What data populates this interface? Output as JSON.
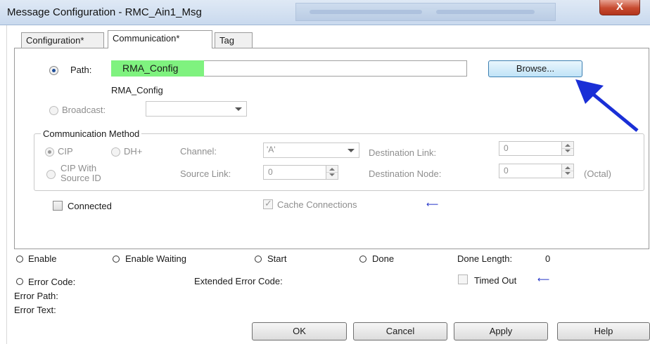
{
  "window": {
    "title": "Message Configuration - RMC_Ain1_Msg",
    "close_label": "X"
  },
  "tabs": [
    {
      "label": "Configuration*",
      "active": false
    },
    {
      "label": "Communication*",
      "active": true
    },
    {
      "label": "Tag",
      "active": false
    }
  ],
  "path": {
    "label": "Path:",
    "value": "RMA_Config",
    "resolved": "RMA_Config",
    "selected": true,
    "browse_label": "Browse..."
  },
  "broadcast": {
    "label": "Broadcast:",
    "value": ""
  },
  "comm_method": {
    "title": "Communication Method",
    "cip_label": "CIP",
    "dh_label": "DH+",
    "cip_with_source_label_1": "CIP With",
    "cip_with_source_label_2": "Source ID",
    "channel_label": "Channel:",
    "channel_value": "'A'",
    "source_link_label": "Source Link:",
    "source_link_value": "0",
    "destination_link_label": "Destination Link:",
    "destination_link_value": "0",
    "destination_node_label": "Destination Node:",
    "destination_node_value": "0",
    "octal_label": "(Octal)"
  },
  "options": {
    "connected_label": "Connected",
    "connected_checked": false,
    "cache_label": "Cache Connections",
    "cache_checked": true
  },
  "status": {
    "enable": "Enable",
    "enable_waiting": "Enable Waiting",
    "start": "Start",
    "done": "Done",
    "done_length_label": "Done Length:",
    "done_length_value": "0",
    "error_code": "Error Code:",
    "extended_error_code": "Extended Error Code:",
    "timed_out": "Timed Out",
    "error_path": "Error Path:",
    "error_text": "Error Text:"
  },
  "buttons": {
    "ok": "OK",
    "cancel": "Cancel",
    "apply": "Apply",
    "help": "Help"
  },
  "colors": {
    "path_highlight": "#7ff27f",
    "annotation_arrow": "#1a2fd6"
  }
}
